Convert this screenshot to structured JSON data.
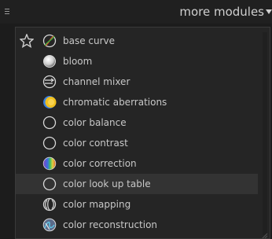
{
  "header": {
    "menu_icon": "hamburger-icon",
    "title": "more modules",
    "arrow_icon": "dropdown-arrow-icon"
  },
  "modules": [
    {
      "label": "base curve",
      "icon": "base-curve-icon",
      "favorite": true
    },
    {
      "label": "bloom",
      "icon": "bloom-icon",
      "favorite": false
    },
    {
      "label": "channel mixer",
      "icon": "channel-mixer-icon",
      "favorite": false
    },
    {
      "label": "chromatic aberrations",
      "icon": "chromatic-aberrations-icon",
      "favorite": false
    },
    {
      "label": "color balance",
      "icon": "color-balance-icon",
      "favorite": false
    },
    {
      "label": "color contrast",
      "icon": "color-contrast-icon",
      "favorite": false
    },
    {
      "label": "color correction",
      "icon": "color-correction-icon",
      "favorite": false
    },
    {
      "label": "color look up table",
      "icon": "color-lut-icon",
      "favorite": false,
      "highlighted": true
    },
    {
      "label": "color mapping",
      "icon": "color-mapping-icon",
      "favorite": false
    },
    {
      "label": "color reconstruction",
      "icon": "color-reconstruction-icon",
      "favorite": false
    }
  ]
}
